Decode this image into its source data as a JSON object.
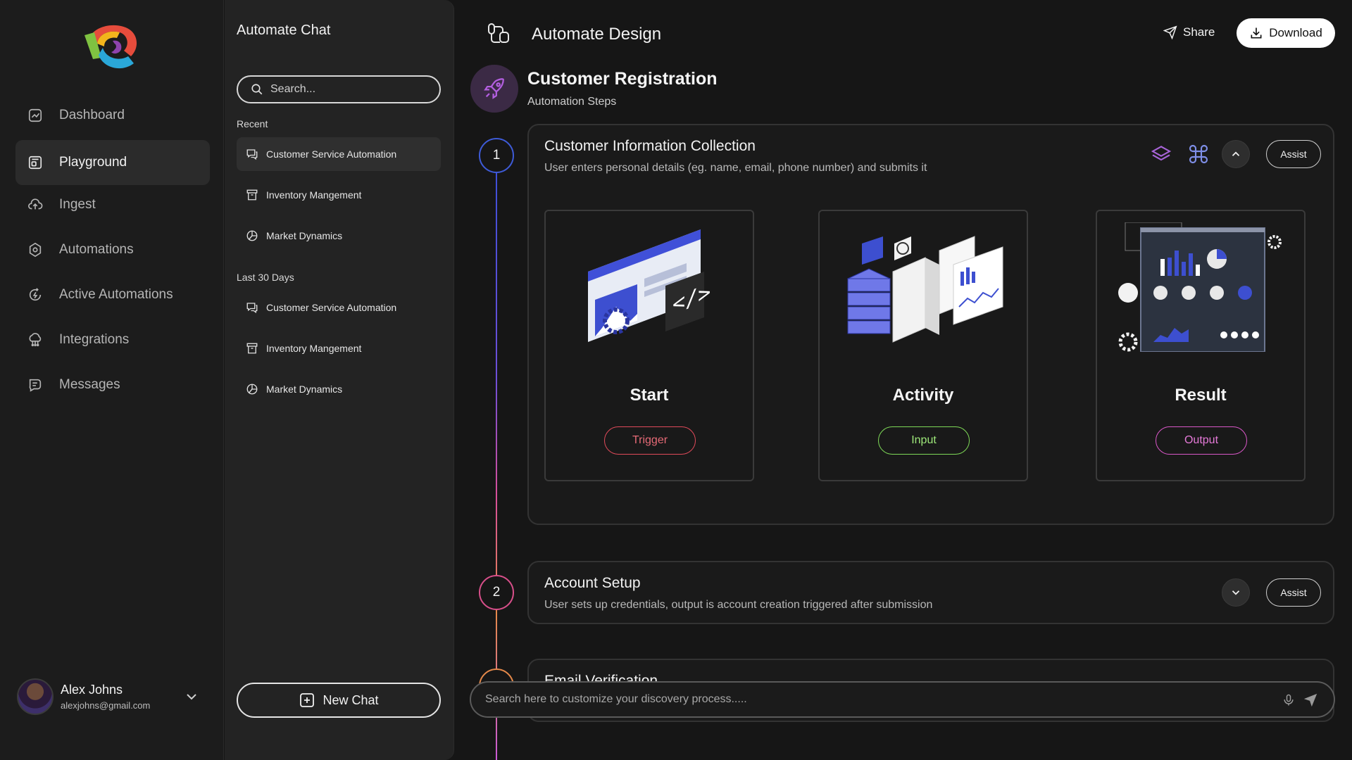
{
  "nav": {
    "items": [
      {
        "label": "Dashboard",
        "icon": "dashboard-icon"
      },
      {
        "label": "Playground",
        "icon": "playground-icon",
        "active": true
      },
      {
        "label": "Ingest",
        "icon": "cloud-upload-icon"
      },
      {
        "label": "Automations",
        "icon": "automations-icon"
      },
      {
        "label": "Active Automations",
        "icon": "refresh-bolt-icon"
      },
      {
        "label": "Integrations",
        "icon": "integrations-icon"
      },
      {
        "label": "Messages",
        "icon": "messages-icon"
      }
    ],
    "user": {
      "name": "Alex Johns",
      "email": "alexjohns@gmail.com"
    }
  },
  "chat": {
    "title": "Automate Chat",
    "search_placeholder": "Search...",
    "recent_label": "Recent",
    "recent": [
      {
        "label": "Customer Service Automation",
        "icon": "chat-bubbles-icon"
      },
      {
        "label": "Inventory Mangement",
        "icon": "archive-box-icon"
      },
      {
        "label": "Market Dynamics",
        "icon": "pie-chart-icon"
      }
    ],
    "last30_label": "Last 30 Days",
    "last30": [
      {
        "label": "Customer Service Automation",
        "icon": "chat-bubbles-icon"
      },
      {
        "label": "Inventory Mangement",
        "icon": "archive-box-icon"
      },
      {
        "label": "Market Dynamics",
        "icon": "pie-chart-icon"
      }
    ],
    "new_chat_label": "New Chat"
  },
  "header": {
    "title": "Automate Design",
    "share_label": "Share",
    "download_label": "Download"
  },
  "project": {
    "title": "Customer Registration",
    "subtitle": "Automation Steps"
  },
  "steps": [
    {
      "number": "1",
      "title": "Customer Information Collection",
      "description": "User enters personal details (eg. name, email, phone number) and submits it",
      "assist_label": "Assist",
      "color": "#3e5bd8",
      "phases": [
        {
          "name": "Start",
          "button": "Trigger",
          "color": "#e04a5a"
        },
        {
          "name": "Activity",
          "button": "Input",
          "color": "#7ed957"
        },
        {
          "name": "Result",
          "button": "Output",
          "color": "#d957c8"
        }
      ]
    },
    {
      "number": "2",
      "title": "Account Setup",
      "description": "User sets up credentials, output is account creation triggered after submission",
      "assist_label": "Assist",
      "color": "#d84f8a"
    },
    {
      "title": "Email Verification",
      "color": "#e5894a"
    }
  ],
  "prompt": {
    "placeholder": "Search here to customize your discovery process....."
  },
  "colors": {
    "accent_purple": "#a864d8",
    "background": "#161616"
  }
}
